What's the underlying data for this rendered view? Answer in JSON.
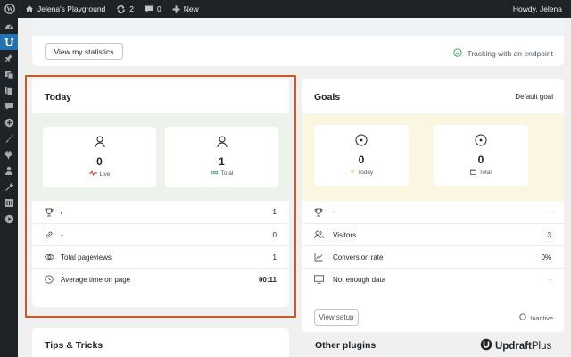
{
  "adminbar": {
    "site_name": "Jelena's Playground",
    "updates_count": "2",
    "comments_count": "0",
    "new_label": "New",
    "greeting": "Howdy, Jelena"
  },
  "sidebar": {
    "items": [
      "dashboard-icon",
      "plugin-icon",
      "pin-icon",
      "media-icon",
      "pages-icon",
      "comments-icon",
      "add-icon",
      "appearance-icon",
      "plugins-icon",
      "users-icon",
      "tools-icon",
      "settings-icon",
      "play-icon"
    ]
  },
  "top": {
    "statistics_button": "View my statistics",
    "tracking_text": "Tracking with an endpoint"
  },
  "today": {
    "title": "Today",
    "live_value": "0",
    "live_label": "Live",
    "total_value": "1",
    "total_label": "Total",
    "rows": [
      {
        "icon": "trophy-icon",
        "label": "/",
        "value": "1"
      },
      {
        "icon": "link-icon",
        "label": "-",
        "value": "0"
      },
      {
        "icon": "eye-icon",
        "label": "Total pageviews",
        "value": "1"
      },
      {
        "icon": "clock-icon",
        "label": "Average time on page",
        "value": "00:11"
      }
    ]
  },
  "goals": {
    "title": "Goals",
    "selector": "Default goal",
    "today_value": "0",
    "today_label": "Today",
    "total_value": "0",
    "total_label": "Total",
    "rows": [
      {
        "icon": "trophy-icon",
        "label": "-",
        "value": "-"
      },
      {
        "icon": "users-icon",
        "label": "Visitors",
        "value": "3"
      },
      {
        "icon": "chart-icon",
        "label": "Conversion rate",
        "value": "0%"
      },
      {
        "icon": "monitor-icon",
        "label": "Not enough data",
        "value": "-"
      }
    ],
    "setup_button": "View setup",
    "status": "Inactive"
  },
  "tips": {
    "title": "Tips & Tricks"
  },
  "other_plugins": {
    "title": "Other plugins",
    "logo_text_a": "Updraft",
    "logo_text_b": "Plus"
  },
  "colors": {
    "highlight": "#c65a2a",
    "today_tint": "#edf3ea",
    "goals_tint": "#fbf6e1",
    "accent": "#2271b1",
    "adminbar": "#1d2327"
  }
}
